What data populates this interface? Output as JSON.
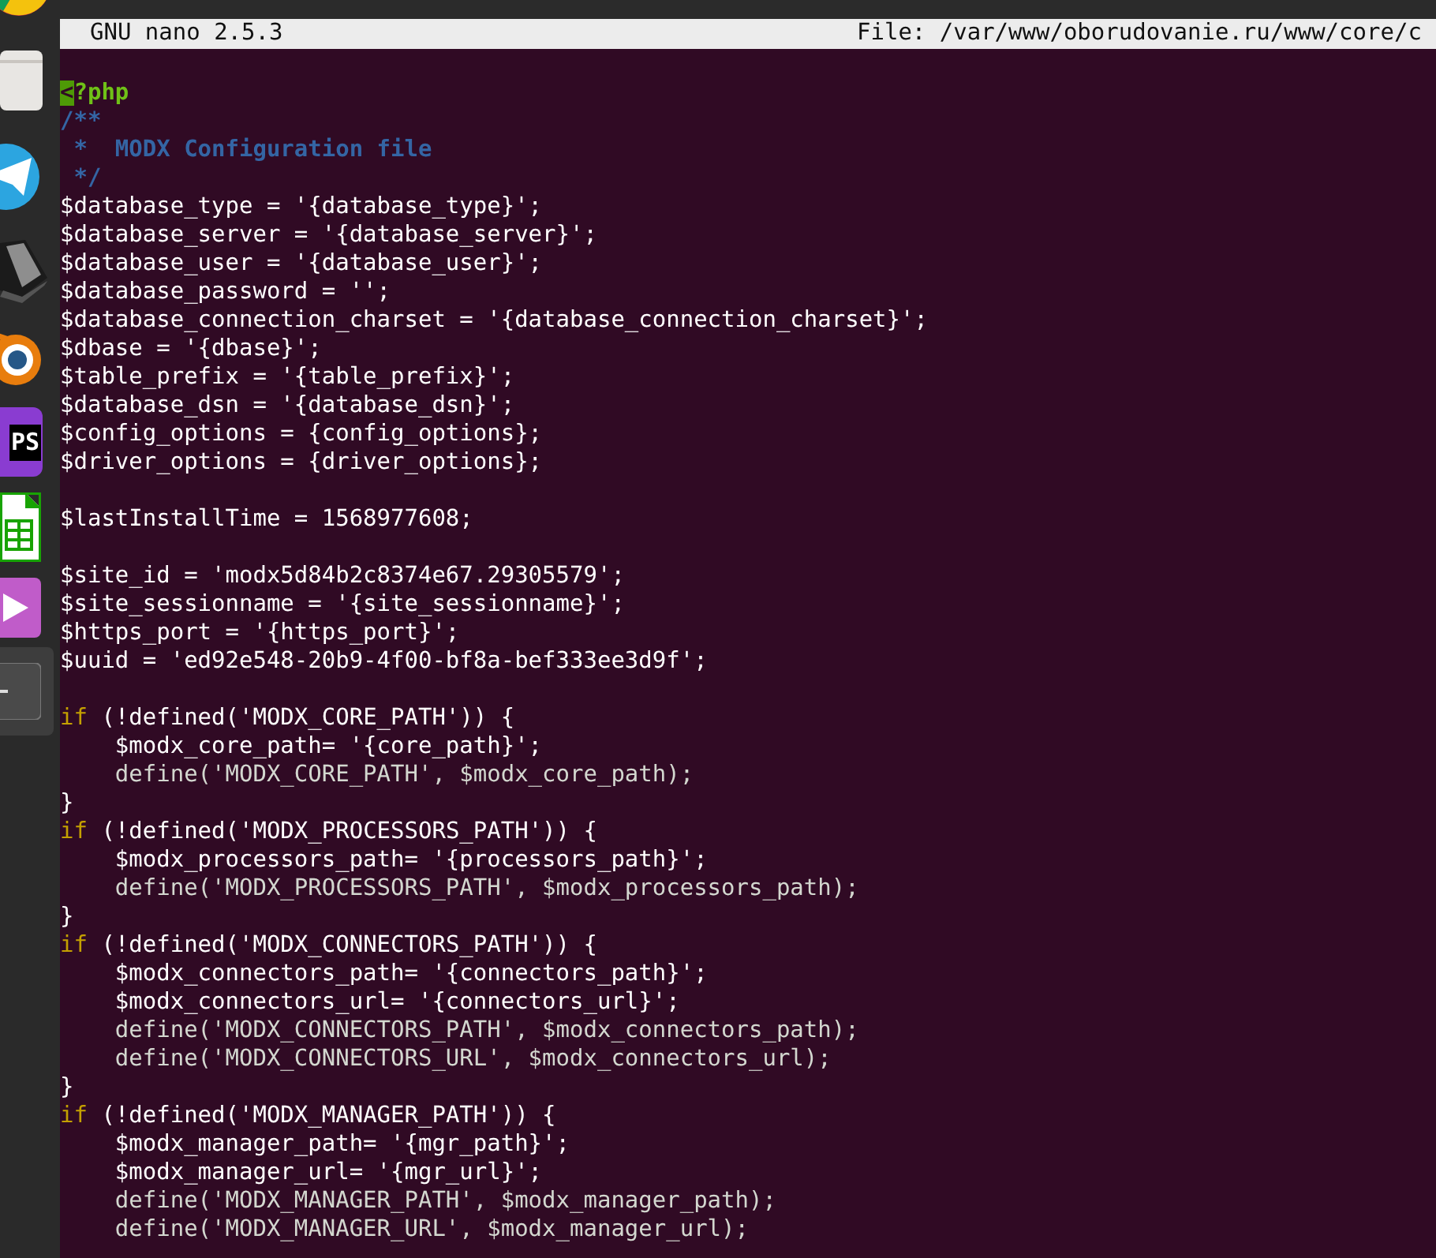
{
  "dock": [
    {
      "kind": "chrome"
    },
    {
      "kind": "files"
    },
    {
      "kind": "telegram"
    },
    {
      "kind": "drive"
    },
    {
      "kind": "blender"
    },
    {
      "kind": "phpstorm",
      "label": "PS"
    },
    {
      "kind": "calc"
    },
    {
      "kind": "video"
    },
    {
      "kind": "terminal",
      "selected": true
    }
  ],
  "header": {
    "title": "GNU nano 2.5.3",
    "file": "File: /var/www/oborudovanie.ru/www/core/c"
  },
  "lines": [
    {
      "kind": "blank"
    },
    {
      "kind": "tag",
      "cursor": "<",
      "text": "?php"
    },
    {
      "kind": "comment",
      "text": "/**"
    },
    {
      "kind": "comment",
      "text": " *  MODX Configuration file"
    },
    {
      "kind": "comment",
      "text": " */"
    },
    {
      "kind": "code",
      "text": "$database_type = '{database_type}';"
    },
    {
      "kind": "code",
      "text": "$database_server = '{database_server}';"
    },
    {
      "kind": "code",
      "text": "$database_user = '{database_user}';"
    },
    {
      "kind": "code",
      "text": "$database_password = '';"
    },
    {
      "kind": "code",
      "text": "$database_connection_charset = '{database_connection_charset}';"
    },
    {
      "kind": "code",
      "text": "$dbase = '{dbase}';"
    },
    {
      "kind": "code",
      "text": "$table_prefix = '{table_prefix}';"
    },
    {
      "kind": "code",
      "text": "$database_dsn = '{database_dsn}';"
    },
    {
      "kind": "code",
      "text": "$config_options = {config_options};"
    },
    {
      "kind": "code",
      "text": "$driver_options = {driver_options};"
    },
    {
      "kind": "blank"
    },
    {
      "kind": "code",
      "text": "$lastInstallTime = 1568977608;"
    },
    {
      "kind": "blank"
    },
    {
      "kind": "code",
      "text": "$site_id = 'modx5d84b2c8374e67.29305579';"
    },
    {
      "kind": "code",
      "text": "$site_sessionname = '{site_sessionname}';"
    },
    {
      "kind": "code",
      "text": "$https_port = '{https_port}';"
    },
    {
      "kind": "code",
      "text": "$uuid = 'ed92e548-20b9-4f00-bf8a-bef333ee3d9f';"
    },
    {
      "kind": "blank"
    },
    {
      "kind": "if",
      "keyword": "if",
      "text": " (!defined('MODX_CORE_PATH')) {"
    },
    {
      "kind": "code",
      "text": "    $modx_core_path= '{core_path}';"
    },
    {
      "kind": "call",
      "text": "    define('MODX_CORE_PATH', $modx_core_path);"
    },
    {
      "kind": "code",
      "text": "}"
    },
    {
      "kind": "if",
      "keyword": "if",
      "text": " (!defined('MODX_PROCESSORS_PATH')) {"
    },
    {
      "kind": "code",
      "text": "    $modx_processors_path= '{processors_path}';"
    },
    {
      "kind": "call",
      "text": "    define('MODX_PROCESSORS_PATH', $modx_processors_path);"
    },
    {
      "kind": "code",
      "text": "}"
    },
    {
      "kind": "if",
      "keyword": "if",
      "text": " (!defined('MODX_CONNECTORS_PATH')) {"
    },
    {
      "kind": "code",
      "text": "    $modx_connectors_path= '{connectors_path}';"
    },
    {
      "kind": "code",
      "text": "    $modx_connectors_url= '{connectors_url}';"
    },
    {
      "kind": "call",
      "text": "    define('MODX_CONNECTORS_PATH', $modx_connectors_path);"
    },
    {
      "kind": "call",
      "text": "    define('MODX_CONNECTORS_URL', $modx_connectors_url);"
    },
    {
      "kind": "code",
      "text": "}"
    },
    {
      "kind": "if",
      "keyword": "if",
      "text": " (!defined('MODX_MANAGER_PATH')) {"
    },
    {
      "kind": "code",
      "text": "    $modx_manager_path= '{mgr_path}';"
    },
    {
      "kind": "code",
      "text": "    $modx_manager_url= '{mgr_url}';"
    },
    {
      "kind": "call",
      "text": "    define('MODX_MANAGER_PATH', $modx_manager_path);"
    },
    {
      "kind": "call",
      "text": "    define('MODX_MANAGER_URL', $modx_manager_url);"
    }
  ]
}
